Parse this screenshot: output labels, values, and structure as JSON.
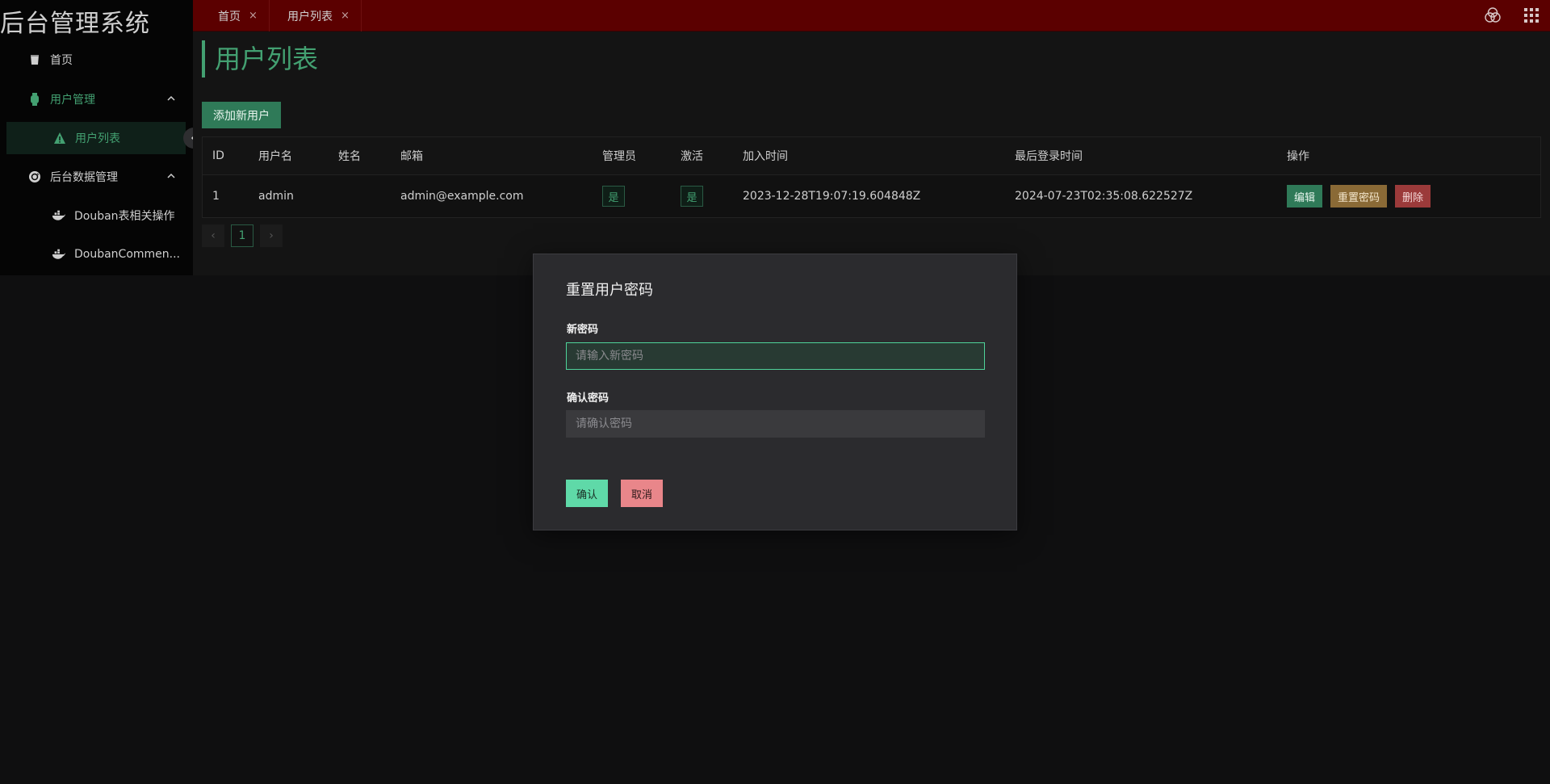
{
  "brand": "后台管理系统",
  "sidebar": {
    "items": [
      {
        "label": "首页",
        "icon": "cup-icon"
      },
      {
        "label": "用户管理",
        "icon": "watch-icon"
      },
      {
        "label": "用户列表",
        "icon": "warning-icon"
      },
      {
        "label": "后台数据管理",
        "icon": "refresh-icon"
      },
      {
        "label": "Douban表相关操作",
        "icon": "docker-icon"
      },
      {
        "label": "DoubanCommen...",
        "icon": "docker-icon"
      }
    ]
  },
  "tabs": [
    {
      "label": "首页",
      "close": "×"
    },
    {
      "label": "用户列表",
      "close": "×"
    }
  ],
  "page": {
    "title": "用户列表",
    "add_button": "添加新用户"
  },
  "table": {
    "headers": [
      "ID",
      "用户名",
      "姓名",
      "邮箱",
      "管理员",
      "激活",
      "加入时间",
      "最后登录时间",
      "操作"
    ],
    "rows": [
      {
        "id": "1",
        "username": "admin",
        "name": "",
        "email": "admin@example.com",
        "admin": "是",
        "active": "是",
        "joined": "2023-12-28T19:07:19.604848Z",
        "last_login": "2024-07-23T02:35:08.622527Z",
        "actions": [
          "编辑",
          "重置密码",
          "删除"
        ]
      }
    ]
  },
  "pagination": {
    "prev": "‹",
    "current": "1",
    "next": "›"
  },
  "modal": {
    "title": "重置用户密码",
    "new_password_label": "新密码",
    "new_password_placeholder": "请输入新密码",
    "confirm_password_label": "确认密码",
    "confirm_password_placeholder": "请确认密码",
    "confirm_button": "确认",
    "cancel_button": "取消"
  },
  "colors": {
    "accent": "#43a071",
    "topbar": "#5b0000",
    "confirm": "#5fd9a8",
    "cancel": "#e9868a"
  }
}
